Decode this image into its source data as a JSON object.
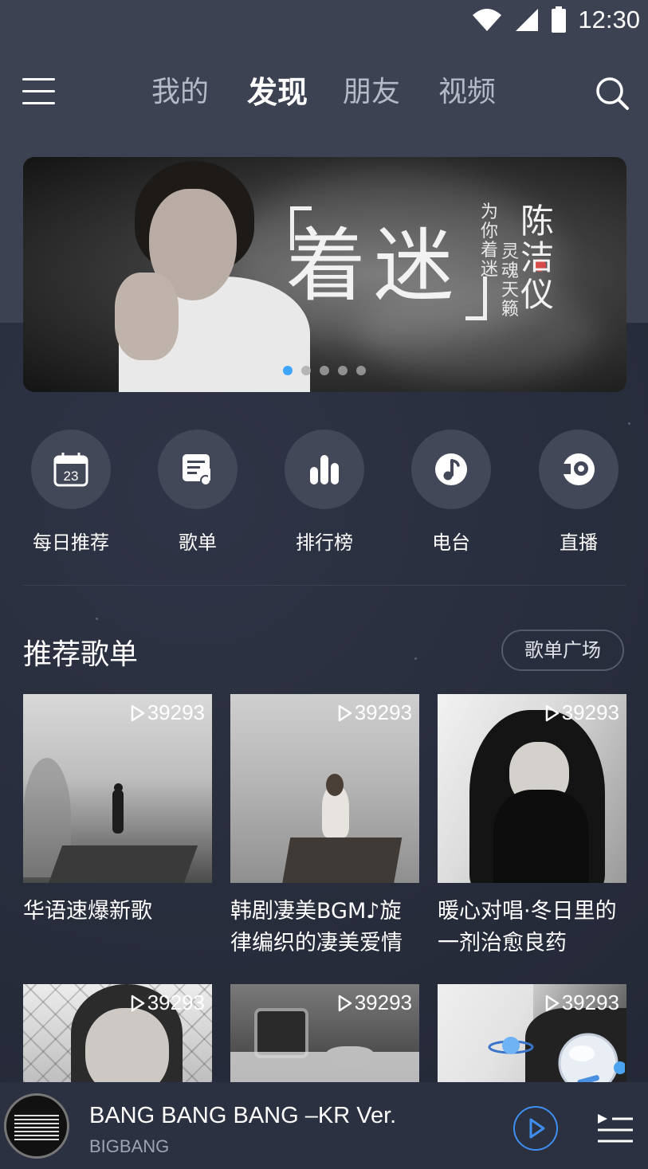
{
  "status_bar": {
    "time": "12:30"
  },
  "header": {
    "tabs": [
      {
        "label": "我的"
      },
      {
        "label": "发现"
      },
      {
        "label": "朋友"
      },
      {
        "label": "视频"
      }
    ],
    "active_tab": "发现"
  },
  "banner": {
    "title": "着迷",
    "subtitle_1": "为你着迷",
    "subtitle_2": "灵魂天籁",
    "artist": "陈洁仪",
    "page_count": 5,
    "active_page": 1
  },
  "quick_nav": [
    {
      "label": "每日推荐",
      "icon": "calendar-icon",
      "icon_text": "23"
    },
    {
      "label": "歌单",
      "icon": "playlist-icon"
    },
    {
      "label": "排行榜",
      "icon": "bar-chart-icon"
    },
    {
      "label": "电台",
      "icon": "radio-icon"
    },
    {
      "label": "直播",
      "icon": "live-icon"
    }
  ],
  "recommend": {
    "title": "推荐歌单",
    "plaza_label": "歌单广场",
    "playlists": [
      {
        "count": "39293",
        "title": "华语速爆新歌"
      },
      {
        "count": "39293",
        "title": "韩剧凄美BGM♪旋律编织的凄美爱情"
      },
      {
        "count": "39293",
        "title": "暖心对唱·冬日里的一剂治愈良药"
      },
      {
        "count": "39293",
        "title": ""
      },
      {
        "count": "39293",
        "title": ""
      },
      {
        "count": "39293",
        "title": ""
      }
    ]
  },
  "player": {
    "song": "BANG BANG BANG –KR Ver.",
    "artist": "BIGBANG",
    "accent": "#3f8ef0"
  }
}
